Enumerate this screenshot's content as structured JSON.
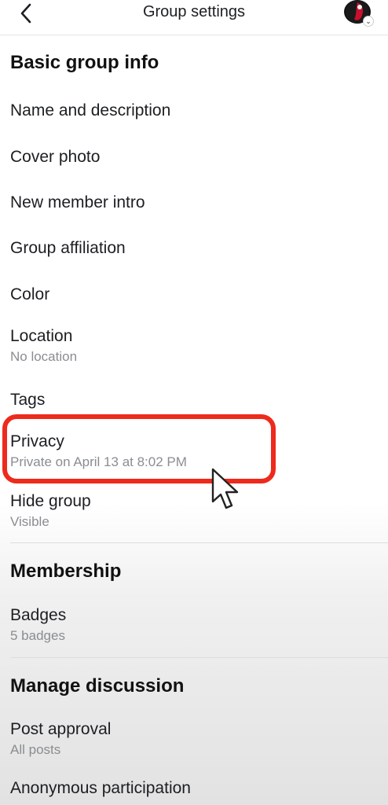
{
  "header": {
    "title": "Group settings",
    "back_icon": "chevron-left-icon",
    "avatar_caret": "chevron-down-icon"
  },
  "sections": {
    "basic": {
      "title": "Basic group info",
      "items": [
        {
          "label": "Name and description"
        },
        {
          "label": "Cover photo"
        },
        {
          "label": "New member intro"
        },
        {
          "label": "Group affiliation"
        },
        {
          "label": "Color"
        },
        {
          "label": "Location",
          "sub": "No location"
        },
        {
          "label": "Tags"
        },
        {
          "label": "Privacy",
          "sub": "Private on April 13 at 8:02 PM"
        },
        {
          "label": "Hide group",
          "sub": "Visible"
        }
      ]
    },
    "membership": {
      "title": "Membership",
      "items": [
        {
          "label": "Badges",
          "sub": "5 badges"
        }
      ]
    },
    "discussion": {
      "title": "Manage discussion",
      "items": [
        {
          "label": "Post approval",
          "sub": "All posts"
        },
        {
          "label": "Anonymous participation"
        }
      ]
    }
  },
  "colors": {
    "highlight": "#ee2a1c",
    "secondary_text": "#8a8d91",
    "primary_text": "#1c1e21"
  }
}
